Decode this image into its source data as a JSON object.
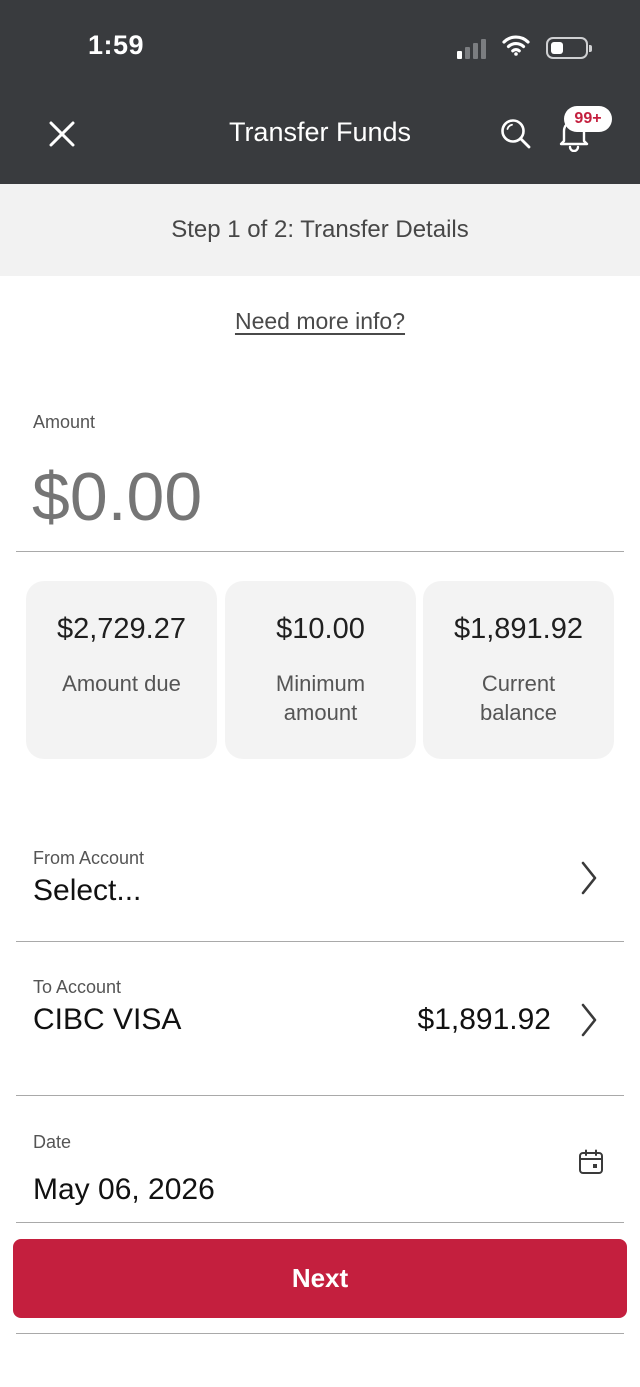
{
  "status_bar": {
    "time": "1:59",
    "icons": [
      "signal-icon",
      "wifi-icon",
      "battery-icon"
    ],
    "signal_bars_active": 1,
    "signal_bars_total": 4
  },
  "header": {
    "title": "Transfer Funds",
    "icons": [
      "close-icon",
      "search-icon",
      "bell-icon"
    ],
    "notification_badge": "99+"
  },
  "step_banner": "Step 1 of 2: Transfer Details",
  "info_link": "Need more info?",
  "amount": {
    "label": "Amount",
    "placeholder": "$0.00"
  },
  "summary_cards": [
    {
      "value": "$2,729.27",
      "label": "Amount due"
    },
    {
      "value": "$10.00",
      "label": "Minimum amount"
    },
    {
      "value": "$1,891.92",
      "label": "Current balance"
    }
  ],
  "from_account": {
    "label": "From Account",
    "value": "Select..."
  },
  "to_account": {
    "label": "To Account",
    "value": "CIBC VISA",
    "amount": "$1,891.92"
  },
  "date_field": {
    "label": "Date",
    "value": "May 06, 2026",
    "icon": "calendar-icon"
  },
  "next_button": "Next",
  "colors": {
    "header_bg": "#393b3e",
    "brand_red": "#c41f3e",
    "banner_bg": "#f2f2f2",
    "card_bg": "#f3f3f3"
  }
}
